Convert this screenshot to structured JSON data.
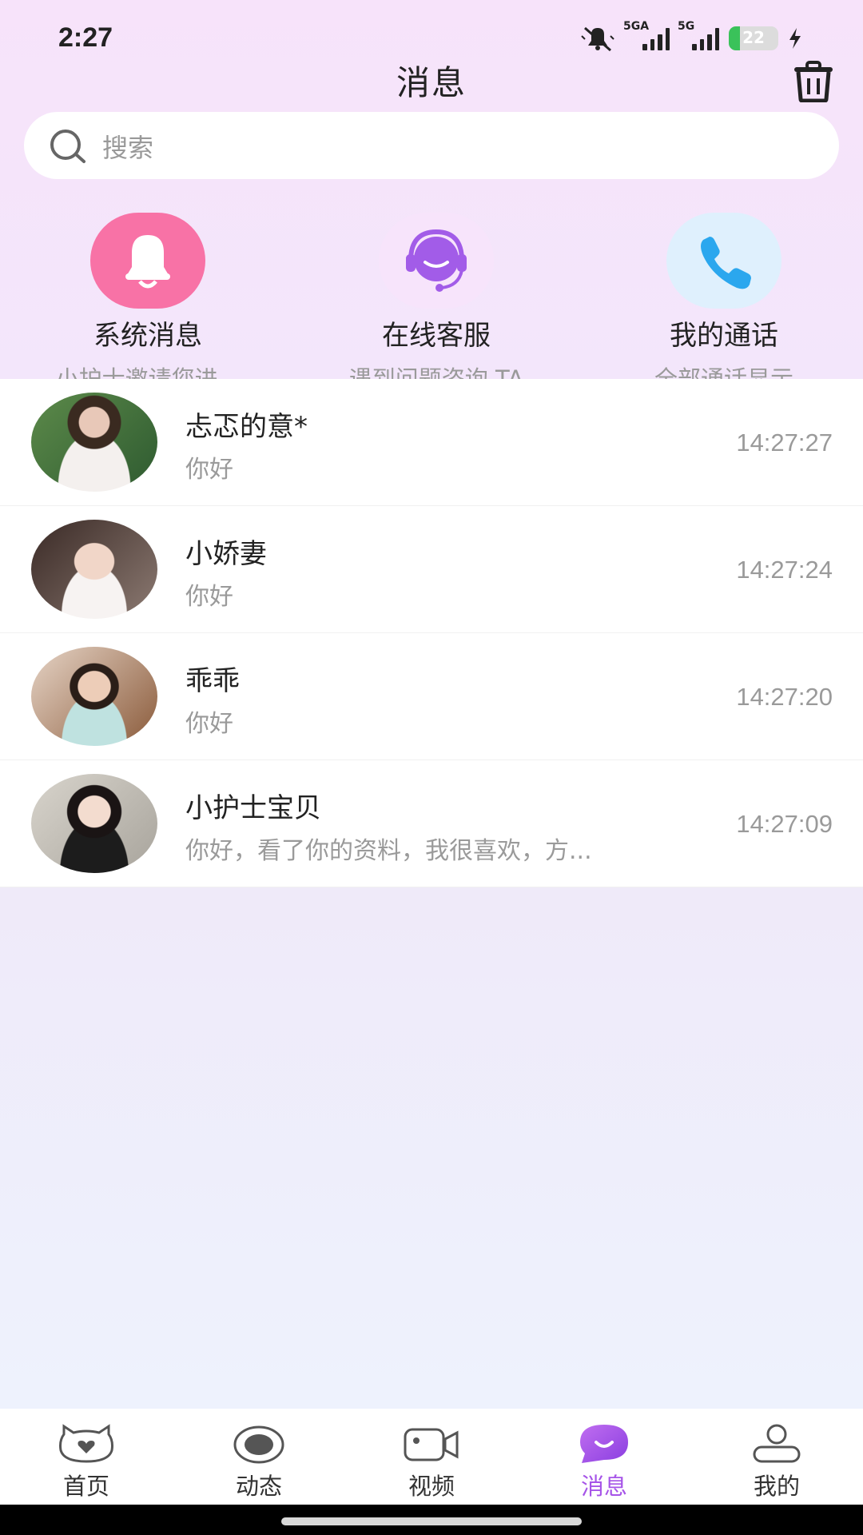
{
  "status_bar": {
    "time": "2:27",
    "signal1_label": "5GA",
    "signal2_label": "5G",
    "battery_percent": "22",
    "battery_level": 0.22,
    "icons": [
      "mute-bell-icon",
      "signal-icon",
      "signal-icon",
      "battery-icon",
      "charging-bolt-icon"
    ]
  },
  "header": {
    "title": "消息",
    "trash_icon": "trash-icon"
  },
  "search": {
    "placeholder": "搜索",
    "icon": "search-icon"
  },
  "quick_entries": [
    {
      "title": "系统消息",
      "subtitle": "小护士邀请您进...",
      "icon": "bell-icon",
      "color": "#f870a8"
    },
    {
      "title": "在线客服",
      "subtitle": "遇到问题咨询 TA",
      "icon": "headset-agent-icon",
      "color": "#a05be8"
    },
    {
      "title": "我的通话",
      "subtitle": "全部通话显示",
      "icon": "phone-icon",
      "color": "#2ba7ee"
    }
  ],
  "conversations": [
    {
      "name": "忐忑的意*",
      "message": "你好",
      "time": "14:27:27"
    },
    {
      "name": "小娇妻",
      "message": "你好",
      "time": "14:27:24"
    },
    {
      "name": "乖乖",
      "message": "你好",
      "time": "14:27:20"
    },
    {
      "name": "小护士宝贝",
      "message": "你好，看了你的资料，我很喜欢，方...",
      "time": "14:27:09"
    }
  ],
  "bottom_nav": [
    {
      "label": "首页",
      "icon": "cat-home-icon",
      "active": false
    },
    {
      "label": "动态",
      "icon": "eye-icon",
      "active": false
    },
    {
      "label": "视频",
      "icon": "video-camera-icon",
      "active": false
    },
    {
      "label": "消息",
      "icon": "chat-bubble-icon",
      "active": true
    },
    {
      "label": "我的",
      "icon": "person-icon",
      "active": false
    }
  ],
  "colors": {
    "accent": "#a654e8",
    "page_bg_top": "#f7e3fa",
    "page_bg_bottom": "#eef2fd"
  }
}
